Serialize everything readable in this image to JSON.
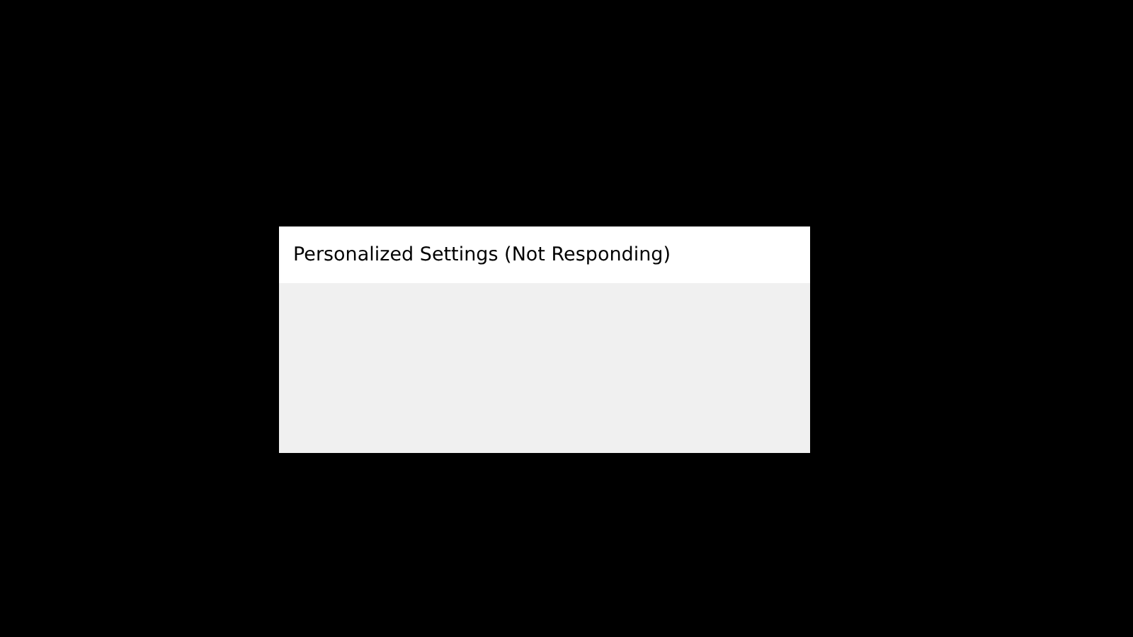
{
  "window": {
    "title": "Personalized Settings (Not Responding)"
  }
}
